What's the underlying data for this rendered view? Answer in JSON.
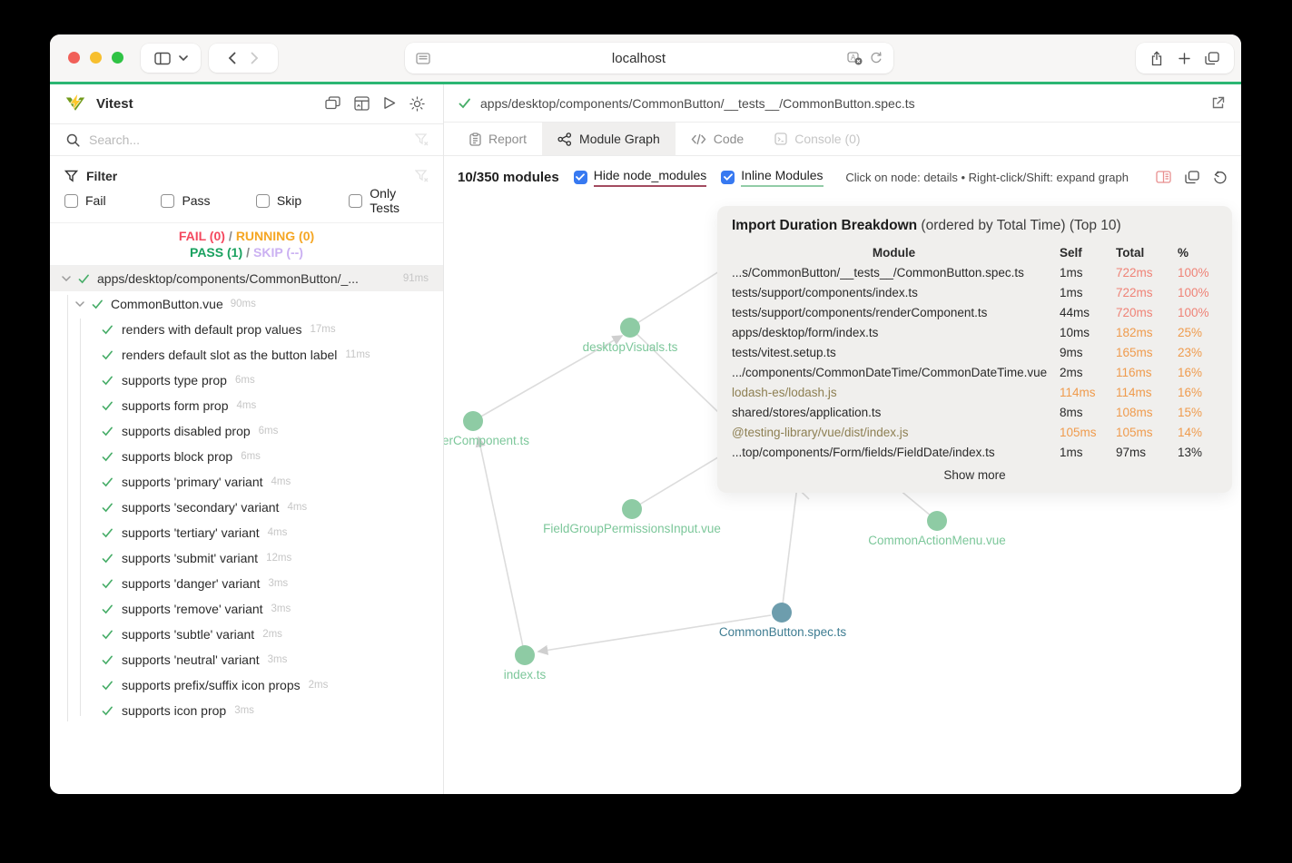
{
  "browser": {
    "url": "localhost"
  },
  "sidebar": {
    "app_title": "Vitest",
    "search_placeholder": "Search...",
    "filter": {
      "label": "Filter",
      "options": [
        {
          "label": "Fail"
        },
        {
          "label": "Pass"
        },
        {
          "label": "Skip"
        },
        {
          "label": "Only Tests"
        }
      ]
    },
    "summary": {
      "fail": "FAIL (0)",
      "running": "RUNNING (0)",
      "pass": "PASS (1)",
      "skip": "SKIP (--)",
      "sep": "/"
    },
    "file": {
      "name": "apps/desktop/components/CommonButton/_...",
      "duration": "91ms"
    },
    "suite": {
      "name": "CommonButton.vue",
      "duration": "90ms"
    },
    "tests": [
      {
        "name": "renders with default prop values",
        "duration": "17ms"
      },
      {
        "name": "renders default slot as the button label",
        "duration": "11ms"
      },
      {
        "name": "supports type prop",
        "duration": "6ms"
      },
      {
        "name": "supports form prop",
        "duration": "4ms"
      },
      {
        "name": "supports disabled prop",
        "duration": "6ms"
      },
      {
        "name": "supports block prop",
        "duration": "6ms"
      },
      {
        "name": "supports 'primary' variant",
        "duration": "4ms"
      },
      {
        "name": "supports 'secondary' variant",
        "duration": "4ms"
      },
      {
        "name": "supports 'tertiary' variant",
        "duration": "4ms"
      },
      {
        "name": "supports 'submit' variant",
        "duration": "12ms"
      },
      {
        "name": "supports 'danger' variant",
        "duration": "3ms"
      },
      {
        "name": "supports 'remove' variant",
        "duration": "3ms"
      },
      {
        "name": "supports 'subtle' variant",
        "duration": "2ms"
      },
      {
        "name": "supports 'neutral' variant",
        "duration": "3ms"
      },
      {
        "name": "supports prefix/suffix icon props",
        "duration": "2ms"
      },
      {
        "name": "supports icon prop",
        "duration": "3ms"
      }
    ]
  },
  "main": {
    "file_path": "apps/desktop/components/CommonButton/__tests__/CommonButton.spec.ts",
    "tabs": [
      {
        "label": "Report"
      },
      {
        "label": "Module Graph"
      },
      {
        "label": "Code"
      },
      {
        "label": "Console (0)"
      }
    ],
    "toolbar": {
      "modules_count": "10/350 modules",
      "hide_node_modules": "Hide node_modules",
      "inline_modules": "Inline Modules",
      "hint": "Click on node: details • Right-click/Shift: expand graph"
    },
    "graph": {
      "nodes": [
        {
          "label": "desktopVisuals.ts"
        },
        {
          "label": "erComponent.ts"
        },
        {
          "label": "FieldGroupPermissionsInput.vue"
        },
        {
          "label": "CommonActionMenu.vue"
        },
        {
          "label": "CommonButton.spec.ts"
        },
        {
          "label": "index.ts"
        }
      ]
    },
    "panel": {
      "title": "Import Duration Breakdown",
      "subtitle": "(ordered by Total Time) (Top 10)",
      "columns": [
        "Module",
        "Self",
        "Total",
        "%"
      ],
      "rows": [
        {
          "module": "...s/CommonButton/__tests__/CommonButton.spec.ts",
          "self": "1ms",
          "total": "722ms",
          "pct": "100%"
        },
        {
          "module": "tests/support/components/index.ts",
          "self": "1ms",
          "total": "722ms",
          "pct": "100%"
        },
        {
          "module": "tests/support/components/renderComponent.ts",
          "self": "44ms",
          "total": "720ms",
          "pct": "100%"
        },
        {
          "module": "apps/desktop/form/index.ts",
          "self": "10ms",
          "total": "182ms",
          "pct": "25%"
        },
        {
          "module": "tests/vitest.setup.ts",
          "self": "9ms",
          "total": "165ms",
          "pct": "23%"
        },
        {
          "module": ".../components/CommonDateTime/CommonDateTime.vue",
          "self": "2ms",
          "total": "116ms",
          "pct": "16%"
        },
        {
          "module": "lodash-es/lodash.js",
          "self": "114ms",
          "total": "114ms",
          "pct": "16%"
        },
        {
          "module": "shared/stores/application.ts",
          "self": "8ms",
          "total": "108ms",
          "pct": "15%"
        },
        {
          "module": "@testing-library/vue/dist/index.js",
          "self": "105ms",
          "total": "105ms",
          "pct": "14%"
        },
        {
          "module": "...top/components/Form/fields/FieldDate/index.ts",
          "self": "1ms",
          "total": "97ms",
          "pct": "13%"
        }
      ],
      "show_more": "Show more"
    }
  },
  "colors": {
    "accent_green": "#2bb673",
    "pass_green": "#47ad68",
    "fail_red": "#f4485e",
    "running_amber": "#f5a623",
    "skip_purple": "#cbb1f2",
    "duration_red": "#ef8377",
    "duration_orange": "#ef9b4d",
    "node_green": "#8ecba4",
    "node_active": "#6d9dad",
    "external_module": "#8d7f52",
    "checkbox_blue": "#3779f1"
  }
}
